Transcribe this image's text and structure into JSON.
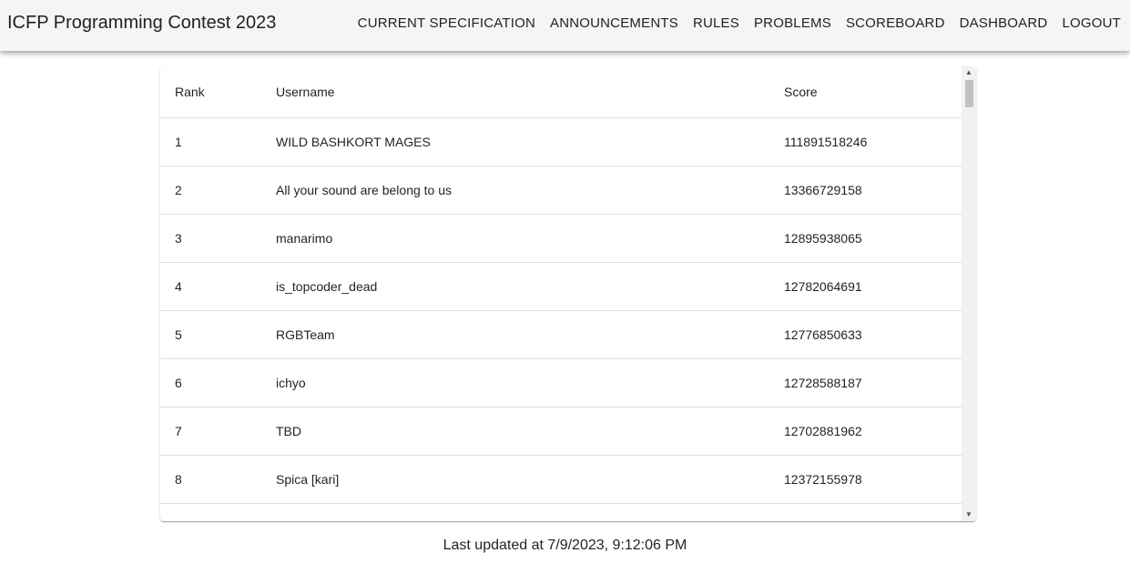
{
  "app": {
    "title": "ICFP Programming Contest 2023"
  },
  "nav": {
    "items": [
      {
        "label": "CURRENT SPECIFICATION"
      },
      {
        "label": "ANNOUNCEMENTS"
      },
      {
        "label": "RULES"
      },
      {
        "label": "PROBLEMS"
      },
      {
        "label": "SCOREBOARD"
      },
      {
        "label": "DASHBOARD"
      },
      {
        "label": "LOGOUT"
      }
    ]
  },
  "scoreboard": {
    "columns": {
      "rank": "Rank",
      "username": "Username",
      "score": "Score"
    },
    "rows": [
      {
        "rank": "1",
        "username": "WILD BASHKORT MAGES",
        "score": "111891518246"
      },
      {
        "rank": "2",
        "username": "All your sound are belong to us",
        "score": "13366729158"
      },
      {
        "rank": "3",
        "username": "manarimo",
        "score": "12895938065"
      },
      {
        "rank": "4",
        "username": "is_topcoder_dead",
        "score": "12782064691"
      },
      {
        "rank": "5",
        "username": "RGBTeam",
        "score": "12776850633"
      },
      {
        "rank": "6",
        "username": "ichyo",
        "score": "12728588187"
      },
      {
        "rank": "7",
        "username": "TBD",
        "score": "12702881962"
      },
      {
        "rank": "8",
        "username": "Spica [kari]",
        "score": "12372155978"
      },
      {
        "rank": "",
        "username": "",
        "score": ""
      }
    ]
  },
  "footer": {
    "last_updated": "Last updated at 7/9/2023, 9:12:06 PM"
  },
  "icons": {
    "scroll_up": "scroll-up-arrow-icon",
    "scroll_down": "scroll-down-arrow-icon"
  }
}
